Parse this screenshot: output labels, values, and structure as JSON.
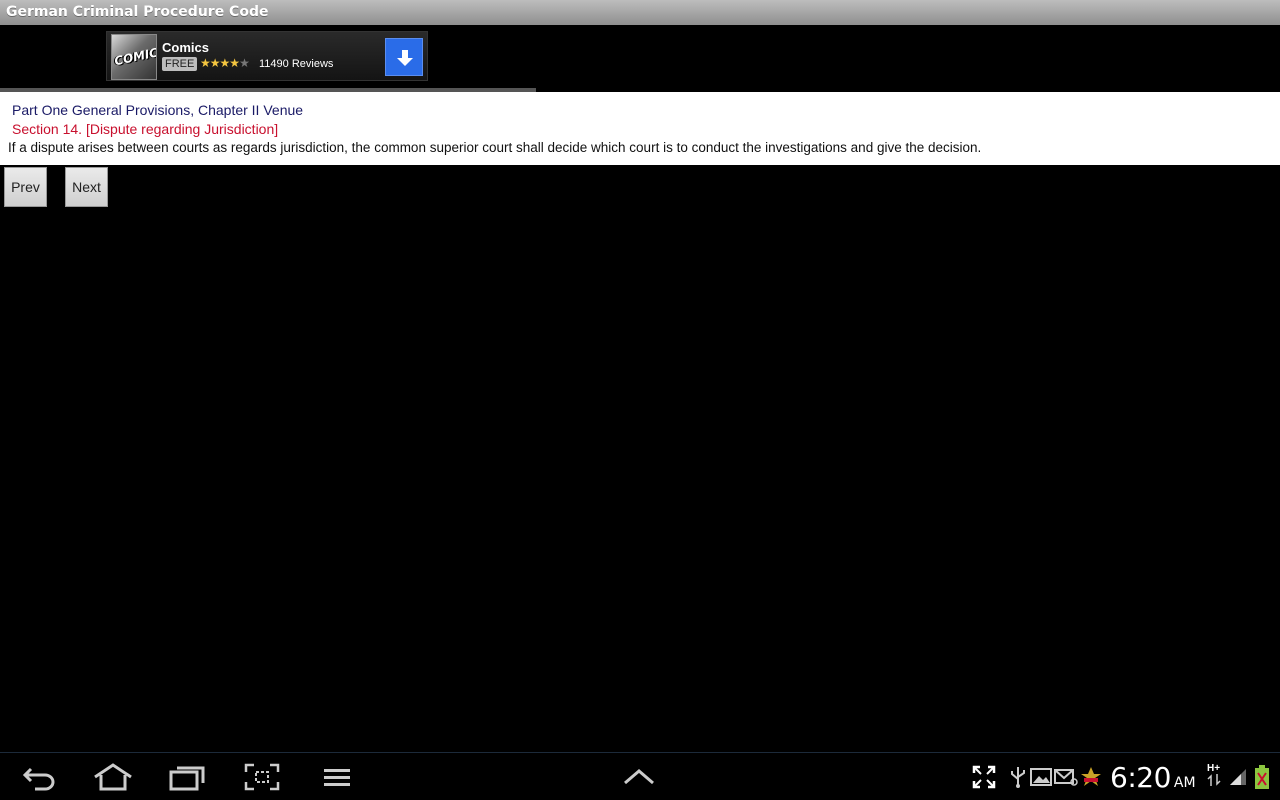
{
  "app": {
    "title": "German Criminal Procedure Code"
  },
  "ad": {
    "name": "Comics",
    "thumb_text": "COMICS",
    "price_badge": "FREE",
    "rating_stars": 4,
    "reviews": "11490 Reviews",
    "download_icon": "download-arrow-icon",
    "accent_color": "#2a6ce8"
  },
  "content": {
    "part": "Part One General Provisions, Chapter II Venue",
    "section": "Section 14. [Dispute regarding Jurisdiction]",
    "text": "If a dispute arises between courts as regards jurisdiction, the common superior court shall decide which court is to conduct the investigations and give the decision.",
    "part_color": "#1a1a66",
    "section_color": "#c8102e"
  },
  "nav": {
    "prev_label": "Prev",
    "next_label": "Next"
  },
  "system_bar": {
    "time": "6:20",
    "ampm": "AM",
    "network": "H+",
    "icons": [
      "back-icon",
      "home-icon",
      "recent-apps-icon",
      "screenshot-icon",
      "menu-icon",
      "up-chevron-icon",
      "fullscreen-icon",
      "usb-icon",
      "gallery-icon",
      "email-icon",
      "notification-icon",
      "signal-icon",
      "battery-icon"
    ]
  }
}
